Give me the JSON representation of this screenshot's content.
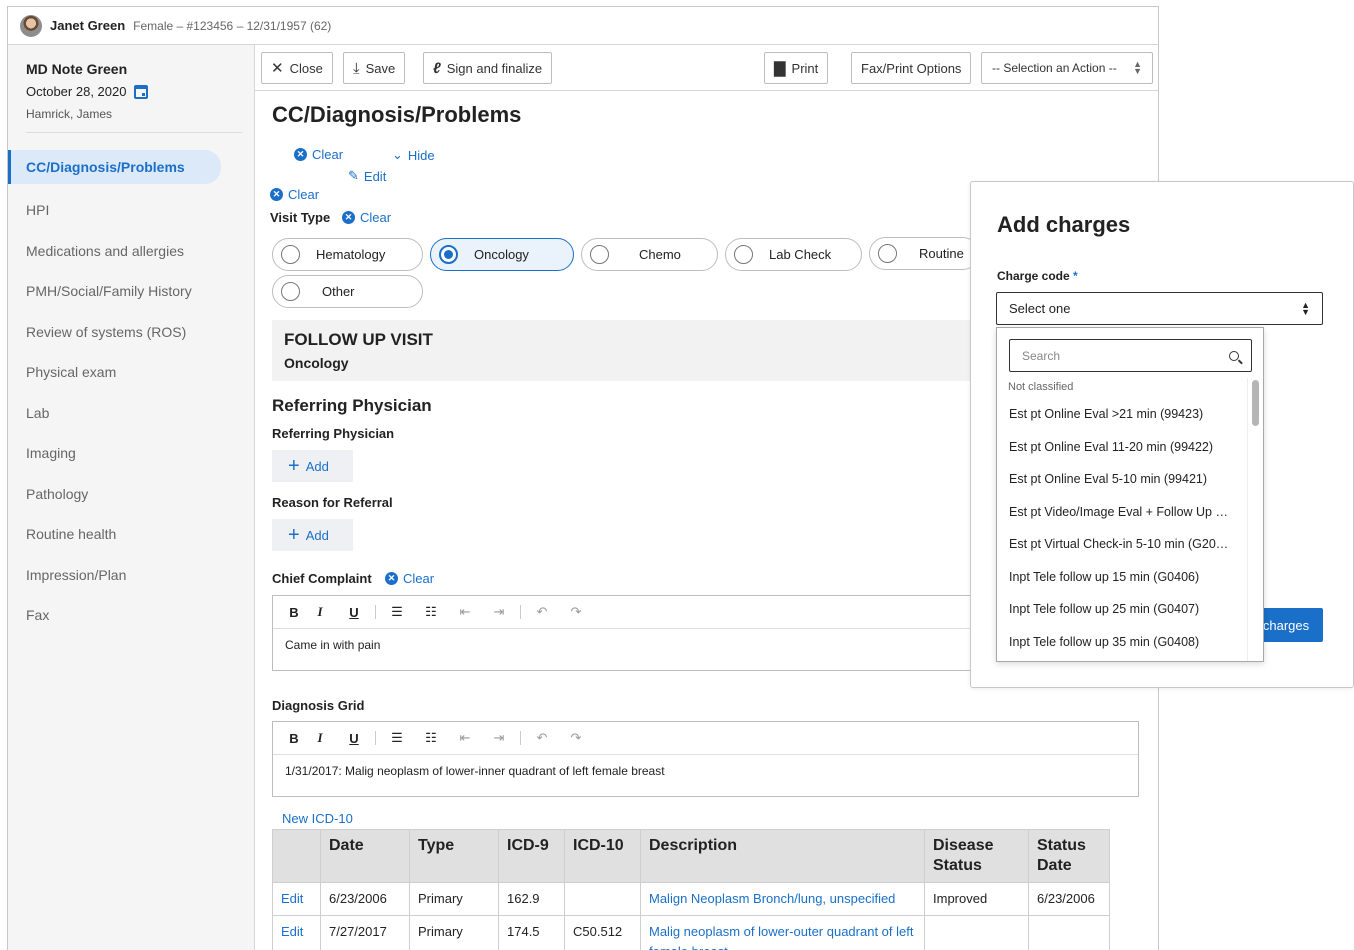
{
  "patient": {
    "name": "Janet Green",
    "info": "Female – #123456 – 12/31/1957 (62)"
  },
  "note": {
    "title": "MD Note Green",
    "date": "October 28, 2020",
    "author": "Hamrick, James"
  },
  "sidebar": {
    "items": [
      {
        "label": "CC/Diagnosis/Problems",
        "active": true
      },
      {
        "label": "HPI"
      },
      {
        "label": "Medications and allergies"
      },
      {
        "label": "PMH/Social/Family History"
      },
      {
        "label": "Review of systems (ROS)"
      },
      {
        "label": "Physical exam"
      },
      {
        "label": "Lab"
      },
      {
        "label": "Imaging"
      },
      {
        "label": "Pathology"
      },
      {
        "label": "Routine health"
      },
      {
        "label": "Impression/Plan"
      },
      {
        "label": "Fax"
      }
    ]
  },
  "toolbar": {
    "close": "Close",
    "save": "Save",
    "sign": "Sign and finalize",
    "print": "Print",
    "fax_print": "Fax/Print Options",
    "action_select": "-- Selection an Action --"
  },
  "section": {
    "title": "CC/Diagnosis/Problems",
    "clear": "Clear",
    "hide": "Hide",
    "edit": "Edit"
  },
  "visit_type": {
    "label": "Visit Type",
    "clear": "Clear",
    "options": [
      "Hematology",
      "Oncology",
      "Chemo",
      "Lab Check",
      "Routine",
      "Other"
    ],
    "selected": "Oncology"
  },
  "followup": {
    "title": "FOLLOW UP VISIT",
    "subtitle": "Oncology"
  },
  "referring": {
    "heading": "Referring Physician",
    "physician_label": "Referring Physician",
    "reason_label": "Reason for Referral",
    "add": "Add"
  },
  "chief_complaint": {
    "label": "Chief Complaint",
    "clear": "Clear",
    "text": "Came in with pain"
  },
  "diagnosis_grid": {
    "label": "Diagnosis Grid",
    "text": "1/31/2017: Malig neoplasm of lower-inner quadrant of left female breast",
    "new_link": "New ICD-10",
    "columns": [
      "",
      "Date",
      "Type",
      "ICD-9",
      "ICD-10",
      "Description",
      "Disease Status",
      "Status Date"
    ],
    "rows": [
      {
        "action": "Edit",
        "date": "6/23/2006",
        "type": "Primary",
        "icd9": "162.9",
        "icd10": "",
        "description": "Malign Neoplasm Bronch/lung, unspecified",
        "status": "Improved",
        "status_date": "6/23/2006"
      },
      {
        "action": "Edit",
        "date": "7/27/2017",
        "type": "Primary",
        "icd9": "174.5",
        "icd10": "C50.512",
        "description": "Malig neoplasm of lower-outer quadrant of left female breast",
        "status": "",
        "status_date": ""
      }
    ]
  },
  "charges_panel": {
    "title": "Add charges",
    "charge_code_label": "Charge code",
    "required_mark": "*",
    "select_placeholder": "Select one",
    "submit_label": "charges",
    "search_placeholder": "Search",
    "group": "Not classified",
    "options": [
      "Est pt Online Eval >21 min (99423)",
      "Est pt Online Eval 11-20 min (99422)",
      "Est pt Online Eval 5-10 min (99421)",
      "Est pt Video/Image Eval + Follow Up …",
      "Est pt Virtual Check-in 5-10 min (G20…",
      "Inpt Tele follow up 15 min (G0406)",
      "Inpt Tele follow up 25 min (G0407)",
      "Inpt Tele follow up 35 min (G0408)"
    ]
  },
  "colors": {
    "accent": "#1a6fc9",
    "active_nav_bg": "#dce9f8",
    "sidebar_bg": "#f5f5f5"
  }
}
